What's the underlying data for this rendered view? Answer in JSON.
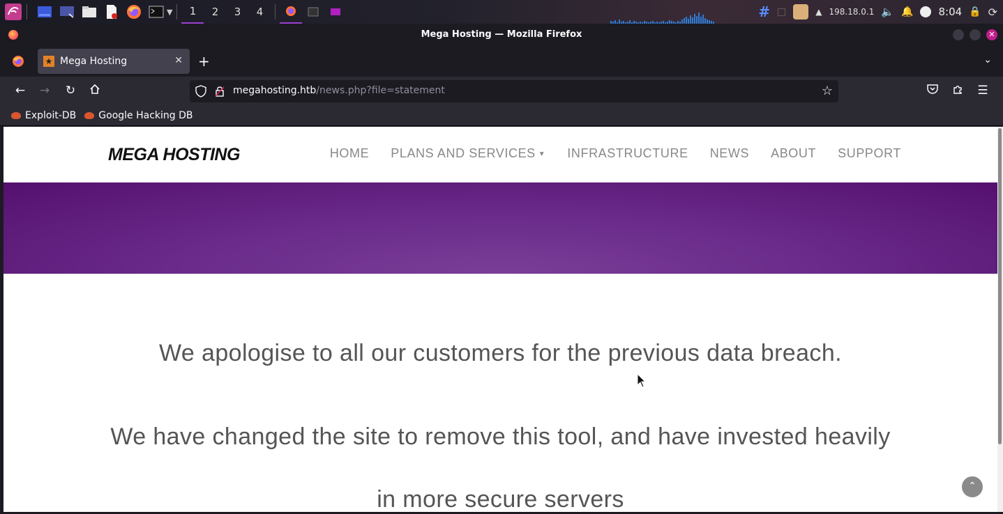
{
  "taskbar": {
    "workspaces": [
      "1",
      "2",
      "3",
      "4"
    ],
    "ip": "198.18.0.1",
    "clock": "8:04"
  },
  "window": {
    "title": "Mega Hosting — Mozilla Firefox"
  },
  "tab": {
    "title": "Mega Hosting"
  },
  "urlbar": {
    "host": "megahosting.htb",
    "path": "/news.php?file=statement"
  },
  "bookmarks": [
    {
      "label": "Exploit-DB"
    },
    {
      "label": "Google Hacking DB"
    }
  ],
  "site": {
    "logo": "MEGA HOSTING",
    "menu": [
      {
        "label": "HOME"
      },
      {
        "label": "PLANS AND SERVICES"
      },
      {
        "label": "INFRASTRUCTURE"
      },
      {
        "label": "NEWS"
      },
      {
        "label": "ABOUT"
      },
      {
        "label": "SUPPORT"
      }
    ],
    "statement": [
      "We apologise to all our customers for the previous data breach.",
      "We have changed the site to remove this tool, and have invested heavily",
      "in more secure servers"
    ]
  }
}
